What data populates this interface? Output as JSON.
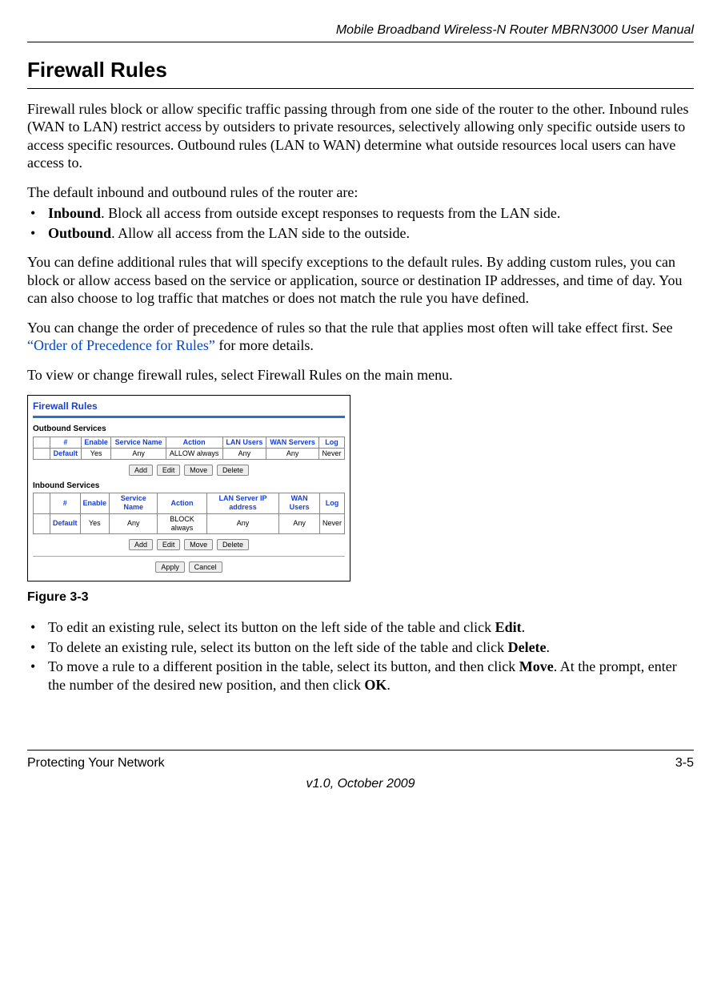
{
  "header": {
    "doc_title": "Mobile Broadband Wireless-N Router MBRN3000 User Manual"
  },
  "section": {
    "title": "Firewall Rules"
  },
  "para1": "Firewall rules block or allow specific traffic passing through from one side of the router to the other. Inbound rules (WAN to LAN) restrict access by outsiders to private resources, selectively allowing only specific outside users to access specific resources. Outbound rules (LAN to WAN) determine what outside resources local users can have access to.",
  "para2": "The default inbound and outbound rules of the router are:",
  "defaults": {
    "inbound_label": "Inbound",
    "inbound_text": ". Block all access from outside except responses to requests from the LAN side.",
    "outbound_label": "Outbound",
    "outbound_text": ". Allow all access from the LAN side to the outside."
  },
  "para3": "You can define additional rules that will specify exceptions to the default rules. By adding custom rules, you can block or allow access based on the service or application, source or destination IP addresses, and time of day. You can also choose to log traffic that matches or does not match the rule you have defined.",
  "para4_pre": "You can change the order of precedence of rules so that the rule that applies most often will take effect first. See ",
  "para4_link": "“Order of Precedence for Rules”",
  "para4_post": " for more details.",
  "para5": "To view or change firewall rules, select Firewall Rules on the main menu.",
  "figure": {
    "panel_title": "Firewall Rules",
    "outbound_heading": "Outbound Services",
    "inbound_heading": "Inbound Services",
    "out_headers": [
      "",
      "#",
      "Enable",
      "Service Name",
      "Action",
      "LAN Users",
      "WAN Servers",
      "Log"
    ],
    "out_row": [
      "",
      "Default",
      "Yes",
      "Any",
      "ALLOW always",
      "Any",
      "Any",
      "Never"
    ],
    "in_headers": [
      "",
      "#",
      "Enable",
      "Service Name",
      "Action",
      "LAN Server IP address",
      "WAN Users",
      "Log"
    ],
    "in_row": [
      "",
      "Default",
      "Yes",
      "Any",
      "BLOCK always",
      "Any",
      "Any",
      "Never"
    ],
    "buttons": {
      "add": "Add",
      "edit": "Edit",
      "move": "Move",
      "delete": "Delete",
      "apply": "Apply",
      "cancel": "Cancel"
    },
    "caption": "Figure 3-3"
  },
  "instructions": {
    "edit_pre": "To edit an existing rule, select its button on the left side of the table and click ",
    "edit_bold": "Edit",
    "edit_post": ".",
    "delete_pre": "To delete an existing rule, select its button on the left side of the table and click ",
    "delete_bold": "Delete",
    "delete_post": ".",
    "move_pre": "To move a rule to a different position in the table, select its button, and then click ",
    "move_bold": "Move",
    "move_mid": ". At the prompt, enter the number of the desired new position, and then click ",
    "move_bold2": "OK",
    "move_post": "."
  },
  "footer": {
    "chapter": "Protecting Your Network",
    "page": "3-5",
    "version": "v1.0, October 2009"
  }
}
